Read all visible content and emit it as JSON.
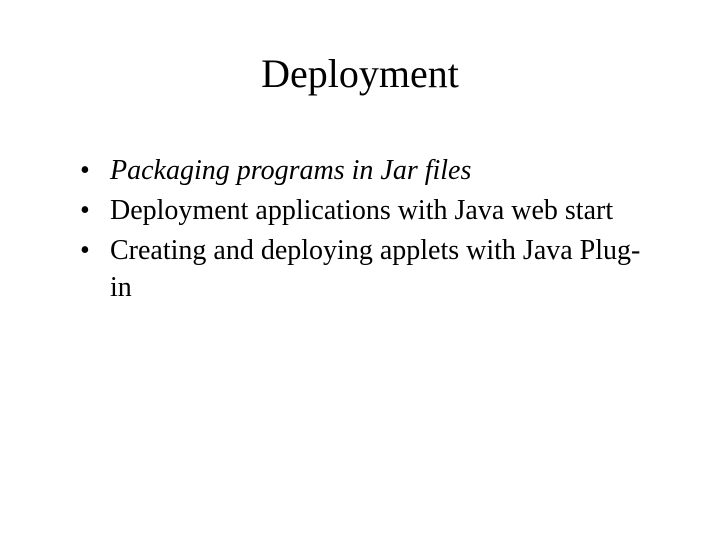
{
  "slide": {
    "title": "Deployment",
    "bullets": [
      {
        "text": "Packaging programs in Jar files",
        "italic": true
      },
      {
        "text": "Deployment applications with Java web start",
        "italic": false
      },
      {
        "text": "Creating and deploying applets with Java Plug-in",
        "italic": false
      }
    ]
  }
}
